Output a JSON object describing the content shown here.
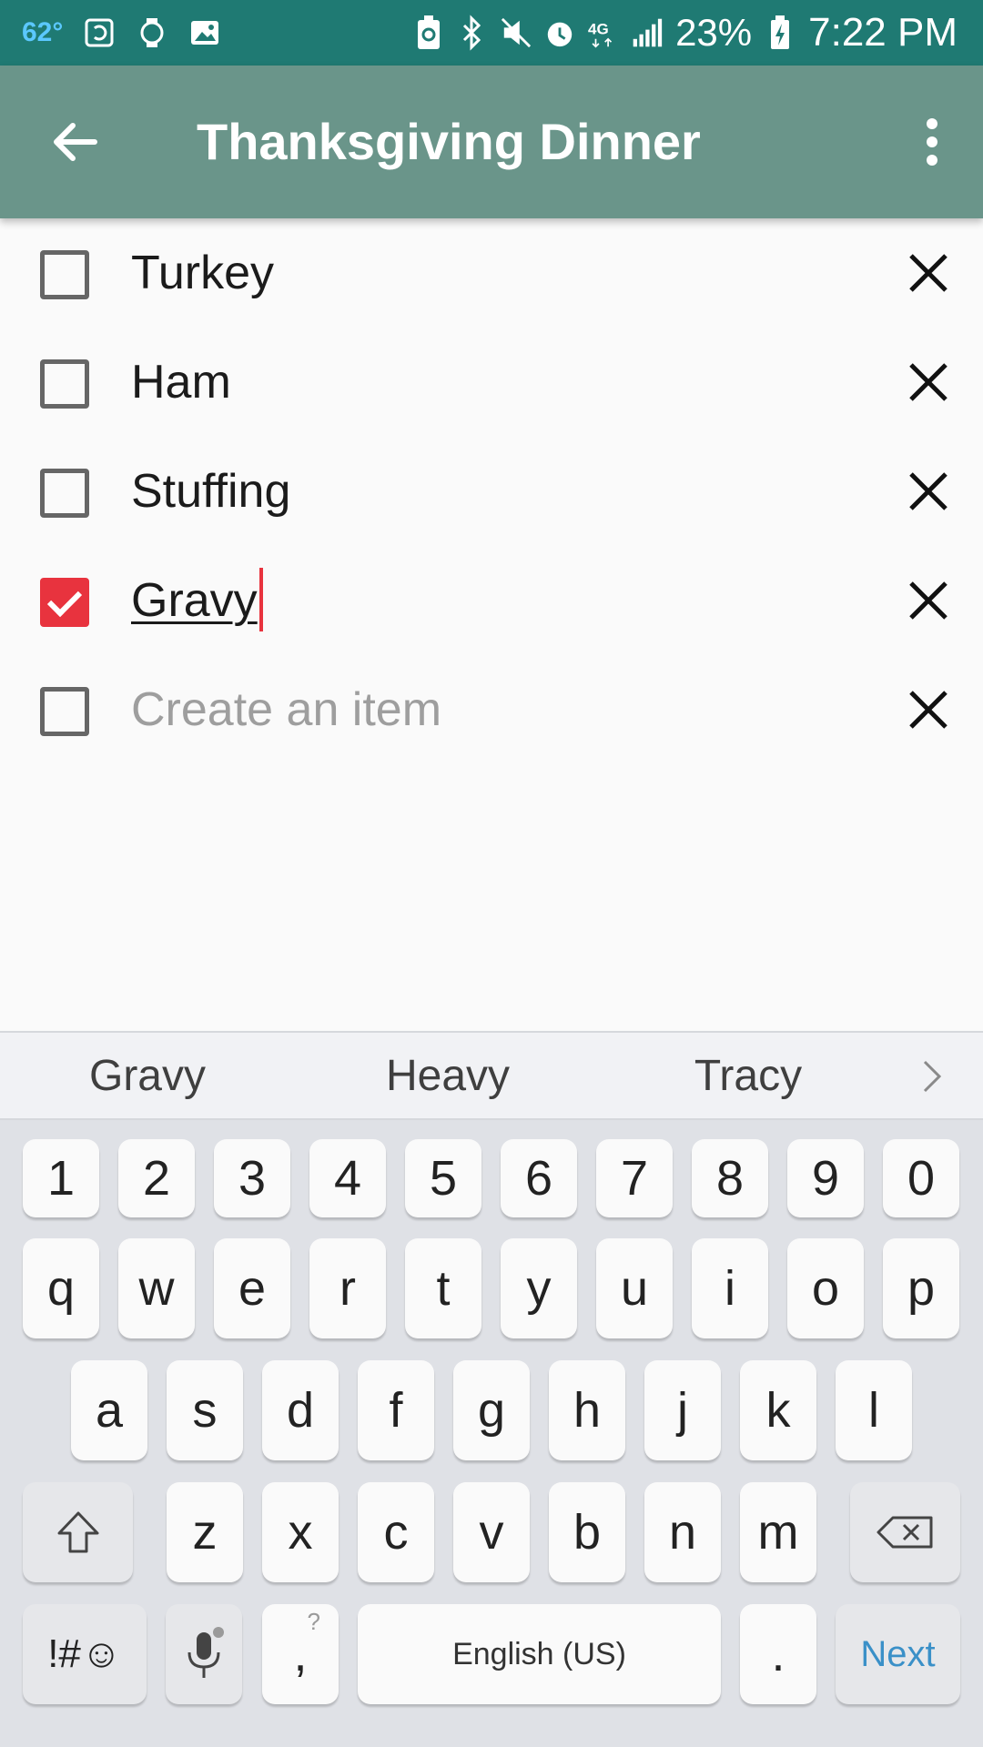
{
  "status_bar": {
    "temperature": "62°",
    "battery_percent": "23%",
    "time": "7:22 PM",
    "left_icons": [
      "screenshot-icon",
      "watch-icon",
      "gallery-icon"
    ],
    "right_icons": [
      "battery-saver-icon",
      "bluetooth-icon",
      "mute-icon",
      "alarm-icon",
      "4g-lte-icon",
      "signal-icon",
      "battery-charging-icon"
    ]
  },
  "app_bar": {
    "title": "Thanksgiving Dinner",
    "color": "#6a958a"
  },
  "list": {
    "items": [
      {
        "label": "Turkey",
        "checked": false
      },
      {
        "label": "Ham",
        "checked": false
      },
      {
        "label": "Stuffing",
        "checked": false
      },
      {
        "label": "Gravy",
        "checked": true,
        "editing": true
      },
      {
        "label": "",
        "checked": false
      }
    ],
    "new_item_placeholder": "Create an item",
    "accent_color": "#e8333e"
  },
  "keyboard": {
    "suggestions": [
      "Gravy",
      "Heavy",
      "Tracy"
    ],
    "number_row": [
      "1",
      "2",
      "3",
      "4",
      "5",
      "6",
      "7",
      "8",
      "9",
      "0"
    ],
    "row1": [
      "q",
      "w",
      "e",
      "r",
      "t",
      "y",
      "u",
      "i",
      "o",
      "p"
    ],
    "row2": [
      "a",
      "s",
      "d",
      "f",
      "g",
      "h",
      "j",
      "k",
      "l"
    ],
    "row3": [
      "z",
      "x",
      "c",
      "v",
      "b",
      "n",
      "m"
    ],
    "symbols_label": "!#☺",
    "comma_key": ",",
    "comma_hint": "?",
    "space_label": "English (US)",
    "period_key": ".",
    "action_label": "Next"
  }
}
